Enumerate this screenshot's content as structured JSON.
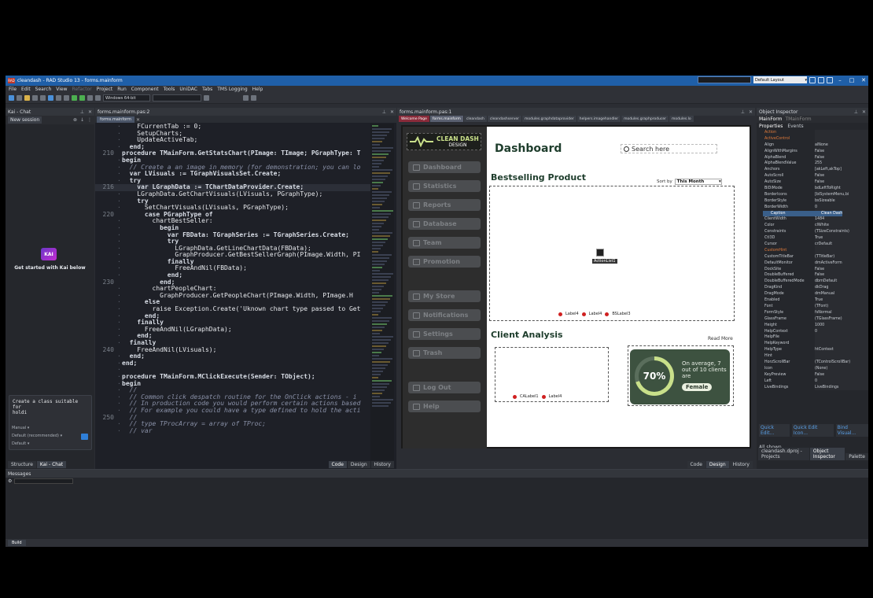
{
  "window": {
    "title": "cleandash - RAD Studio 13 - forms.mainform",
    "layout": "Default Layout"
  },
  "menu": [
    "File",
    "Edit",
    "Search",
    "View",
    "Refactor",
    "Project",
    "Run",
    "Component",
    "Tools",
    "UniDAC",
    "Tabs",
    "TMS Logging",
    "Help"
  ],
  "toolbar": {
    "platform": "Windows 64-bit"
  },
  "kai": {
    "title": "Kai - Chat",
    "session_tab": "New session",
    "logo": "KAI",
    "get_started": "Get started with Kai below",
    "prompt": "Create a class suitable for\nholdi",
    "mode": "Manual",
    "model": "Default (recommended)",
    "profile": "Default",
    "bottom_tabs": [
      "Structure",
      "Kai - Chat"
    ]
  },
  "editor": {
    "title": "forms.mainform.pas:2",
    "tab": "forms.mainform",
    "bottom_tabs": [
      "Code",
      "Design",
      "History"
    ],
    "lines": [
      {
        "n": "",
        "t": "    FCurrentTab := 0;"
      },
      {
        "n": "",
        "t": "    SetupCharts;"
      },
      {
        "n": "",
        "t": "    UpdateActiveTab;"
      },
      {
        "n": "",
        "t": "  end;"
      },
      {
        "n": "210",
        "t": "procedure TMainForm.GetStatsChart(PImage: TImage; PGraphType: T"
      },
      {
        "n": "",
        "t": "begin"
      },
      {
        "n": "",
        "t": "  // Create a an image in memory (for demonstration; you can lo"
      },
      {
        "n": "",
        "t": "  var LVisuals := TGraphVisualsSet.Create;"
      },
      {
        "n": "",
        "t": "  try"
      },
      {
        "n": "216",
        "t": "    var LGraphData := TChartDataProvider.Create;"
      },
      {
        "n": "",
        "t": "    LGraphData.GetChartVisuals(LVisuals, PGraphType);"
      },
      {
        "n": "",
        "t": "    try"
      },
      {
        "n": "",
        "t": "      SetChartVisuals(LVisuals, PGraphType);"
      },
      {
        "n": "220",
        "t": "      case PGraphType of"
      },
      {
        "n": "",
        "t": "        chartBestSeller:"
      },
      {
        "n": "",
        "t": "          begin"
      },
      {
        "n": "",
        "t": "            var FBData: TGraphSeries := TGraphSeries.Create;"
      },
      {
        "n": "",
        "t": "            try"
      },
      {
        "n": "",
        "t": "              LGraphData.GetLineChartData(FBData);"
      },
      {
        "n": "",
        "t": "              GraphProducer.GetBestSellerGraph(PImage.Width, PI"
      },
      {
        "n": "",
        "t": "            finally"
      },
      {
        "n": "",
        "t": "              FreeAndNil(FBData);"
      },
      {
        "n": "",
        "t": "            end;"
      },
      {
        "n": "230",
        "t": "          end;"
      },
      {
        "n": "",
        "t": "        chartPeopleChart:"
      },
      {
        "n": "",
        "t": "          GraphProducer.GetPeopleChart(PImage.Width, PImage.H"
      },
      {
        "n": "",
        "t": "      else"
      },
      {
        "n": "",
        "t": "        raise Exception.Create('Uknown chart type passed to Get"
      },
      {
        "n": "",
        "t": "      end;"
      },
      {
        "n": "",
        "t": "    finally"
      },
      {
        "n": "",
        "t": "      FreeAndNil(LGraphData);"
      },
      {
        "n": "",
        "t": "    end;"
      },
      {
        "n": "",
        "t": "  finally"
      },
      {
        "n": "240",
        "t": "    FreeAndNil(LVisuals);"
      },
      {
        "n": "",
        "t": "  end;"
      },
      {
        "n": "",
        "t": "end;"
      },
      {
        "n": "",
        "t": ""
      },
      {
        "n": "",
        "t": "procedure TMainForm.MClickExecute(Sender: TObject);"
      },
      {
        "n": "",
        "t": "begin"
      },
      {
        "n": "",
        "t": "  //"
      },
      {
        "n": "",
        "t": "  // Common click despatch routine for the OnClick actions - i"
      },
      {
        "n": "",
        "t": "  // In production code you would perform certain actions based"
      },
      {
        "n": "",
        "t": "  // For example you could have a type defined to hold the acti"
      },
      {
        "n": "250",
        "t": "  //"
      },
      {
        "n": "",
        "t": "  // type TProcArray = array of TProc;"
      },
      {
        "n": "",
        "t": "  // var"
      }
    ]
  },
  "designer": {
    "title": "forms.mainform.pas:1",
    "tabs": [
      "Welcome Page",
      "forms.mainform",
      "cleandash",
      "cleandashserver",
      "modules.graphdataprovider",
      "helpers.imagehandler",
      "modules.graphproducer",
      "modules.lo"
    ],
    "bottom_tabs": [
      "Code",
      "Design",
      "History"
    ],
    "app": {
      "brand_line1": "CLEAN DASH",
      "brand_line2": "DESIGN",
      "nav": [
        "Dashboard",
        "Statistics",
        "Reports",
        "Database",
        "Team",
        "Promotion",
        "My Store",
        "Notifications",
        "Settings",
        "Trash",
        "Log Out",
        "Help"
      ],
      "title": "Dashboard",
      "search_placeholder": "Search here",
      "bestselling": "Bestselling Product",
      "sort_label": "Sort by",
      "sort_value": "This Month",
      "legend": [
        "Label4",
        "Label4",
        "BSLabel3"
      ],
      "component_label": "ActionList1",
      "client_analysis": "Client Analysis",
      "read_more": "Read More",
      "ca_legend": [
        "CALabel1",
        "Label4"
      ],
      "card_percent": "70%",
      "card_text": "On average, 7 out of 10 clients are",
      "card_gender": "Female"
    }
  },
  "inspector": {
    "title": "Object Inspector",
    "object": "MainForm",
    "object_type": "TMainForm",
    "tabs": [
      "Properties",
      "Events"
    ],
    "rows": [
      {
        "name": "Action",
        "value": "",
        "cat": true
      },
      {
        "name": "ActiveControl",
        "value": "",
        "cat": true
      },
      {
        "name": "Align",
        "value": "alNone"
      },
      {
        "name": "AlignWithMargins",
        "value": "False"
      },
      {
        "name": "AlphaBlend",
        "value": "False"
      },
      {
        "name": "AlphaBlendValue",
        "value": "255"
      },
      {
        "name": "Anchors",
        "value": "[akLeft,akTop]"
      },
      {
        "name": "AutoScroll",
        "value": "False"
      },
      {
        "name": "AutoSize",
        "value": "False"
      },
      {
        "name": "BiDiMode",
        "value": "bdLeftToRight"
      },
      {
        "name": "BorderIcons",
        "value": "[biSystemMenu,bi"
      },
      {
        "name": "BorderStyle",
        "value": "bsSizeable"
      },
      {
        "name": "BorderWidth",
        "value": "0"
      },
      {
        "name": "Caption",
        "value": "Clean Dash",
        "sel": true
      },
      {
        "name": "ClientHeight",
        "value": "992"
      },
      {
        "name": "ClientWidth",
        "value": "1484"
      },
      {
        "name": "Color",
        "value": "clWhite"
      },
      {
        "name": "Constraints",
        "value": "(TSizeConstraints)"
      },
      {
        "name": "Ctl3D",
        "value": "True"
      },
      {
        "name": "Cursor",
        "value": "crDefault"
      },
      {
        "name": "CustomHint",
        "value": "",
        "cat": true
      },
      {
        "name": "CustomTitleBar",
        "value": "(TTitleBar)"
      },
      {
        "name": "DefaultMonitor",
        "value": "dmActiveForm"
      },
      {
        "name": "DockSite",
        "value": "False"
      },
      {
        "name": "DoubleBuffered",
        "value": "False"
      },
      {
        "name": "DoubleBufferedMode",
        "value": "dbmDefault"
      },
      {
        "name": "DragKind",
        "value": "dkDrag"
      },
      {
        "name": "DragMode",
        "value": "dmManual"
      },
      {
        "name": "Enabled",
        "value": "True"
      },
      {
        "name": "Font",
        "value": "(TFont)"
      },
      {
        "name": "FormStyle",
        "value": "fsNormal"
      },
      {
        "name": "GlassFrame",
        "value": "(TGlassFrame)"
      },
      {
        "name": "Height",
        "value": "1000"
      },
      {
        "name": "HelpContext",
        "value": "0"
      },
      {
        "name": "HelpFile",
        "value": ""
      },
      {
        "name": "HelpKeyword",
        "value": ""
      },
      {
        "name": "HelpType",
        "value": "htContext"
      },
      {
        "name": "Hint",
        "value": ""
      },
      {
        "name": "HorzScrollBar",
        "value": "(TControlScrollBar)"
      },
      {
        "name": "Icon",
        "value": "(None)"
      },
      {
        "name": "KeyPreview",
        "value": "False"
      },
      {
        "name": "Left",
        "value": "0"
      },
      {
        "name": "LiveBindings",
        "value": "LiveBindings"
      }
    ],
    "links": [
      "Quick Edit...",
      "Quick Edit Icon...",
      "Bind Visual..."
    ],
    "filter": "All shown",
    "bottom_tabs": [
      "cleandash.dproj - Projects",
      "Object Inspector",
      "Palette"
    ]
  },
  "messages": {
    "title": "Messages",
    "build_tab": "Build"
  }
}
